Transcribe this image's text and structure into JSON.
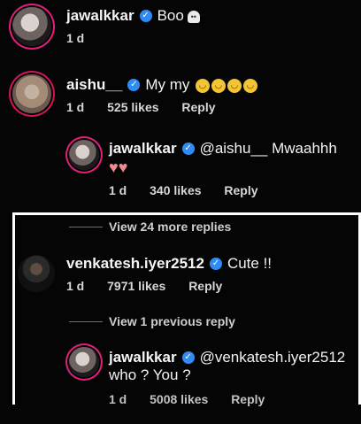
{
  "comments": [
    {
      "username": "jawalkkar",
      "text": "Boo",
      "time": "1 d"
    },
    {
      "username": "aishu__",
      "text": "My my",
      "time": "1 d",
      "likes": "525 likes",
      "reply": "Reply"
    }
  ],
  "reply1": {
    "username": "jawalkkar",
    "text": "@aishu__  Mwaahhh",
    "time": "1 d",
    "likes": "340 likes",
    "reply": "Reply"
  },
  "view_more_24": "View 24 more replies",
  "venkatesh": {
    "username": "venkatesh.iyer2512",
    "text": "Cute !!",
    "time": "1 d",
    "likes": "7971 likes",
    "reply": "Reply"
  },
  "view_previous_1": "View 1 previous reply",
  "reply2": {
    "username": "jawalkkar",
    "mention": "@venkatesh.iyer2512",
    "text": "who ? You ?",
    "time": "1 d",
    "likes": "5008 likes",
    "reply": "Reply"
  },
  "colors": {
    "verified": "#2f8cf6",
    "highlight_box": "#ffffff",
    "story_ring": "#e11f7b"
  },
  "icons": {
    "ghost": "ghost-emoji-icon",
    "emoji": "relieved-face-emoji-icon",
    "heart": "red-heart-emoji-icon",
    "verified": "verified-badge-icon"
  }
}
